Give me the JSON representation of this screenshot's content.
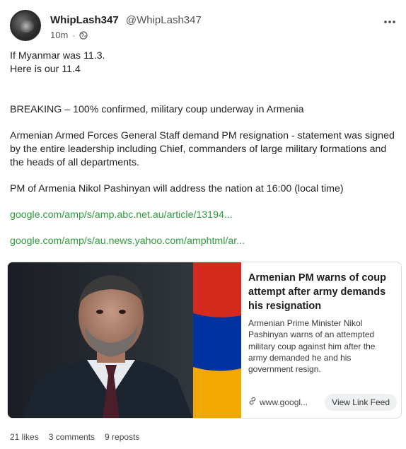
{
  "post": {
    "display_name": "WhipLash347",
    "handle": "@WhipLash347",
    "time": "10m",
    "separator": "·",
    "body": {
      "line1": "If Myanmar was 11.3.",
      "line2": "Here is our 11.4",
      "line3": "BREAKING – 100% confirmed, military coup underway in Armenia",
      "line4": "Armenian Armed Forces General Staff demand PM resignation - statement was signed by the entire leadership including Chief, commanders of large military formations and the heads of all departments.",
      "line5": "PM of Armenia Nikol Pashinyan will address the nation at 16:00 (local time)",
      "link1": "google.com/amp/s/amp.abc.net.au/article/13194...",
      "link2": "google.com/amp/s/au.news.yahoo.com/amphtml/ar..."
    }
  },
  "card": {
    "title": "Armenian PM warns of coup attempt after army demands his resignation",
    "description": "Armenian Prime Minister Nikol Pashinyan warns of an attempted military coup against him after the army demanded he and his government resign.",
    "url": "www.googl...",
    "button_label": "View Link Feed",
    "flag_colors": [
      "#d52b1e",
      "#0033a0",
      "#f2a800"
    ]
  },
  "stats": {
    "likes": "21 likes",
    "comments": "3 comments",
    "reposts": "9 reposts"
  },
  "icons": {
    "more": "more-options-icon",
    "globe": "globe-icon",
    "link": "link-icon"
  }
}
